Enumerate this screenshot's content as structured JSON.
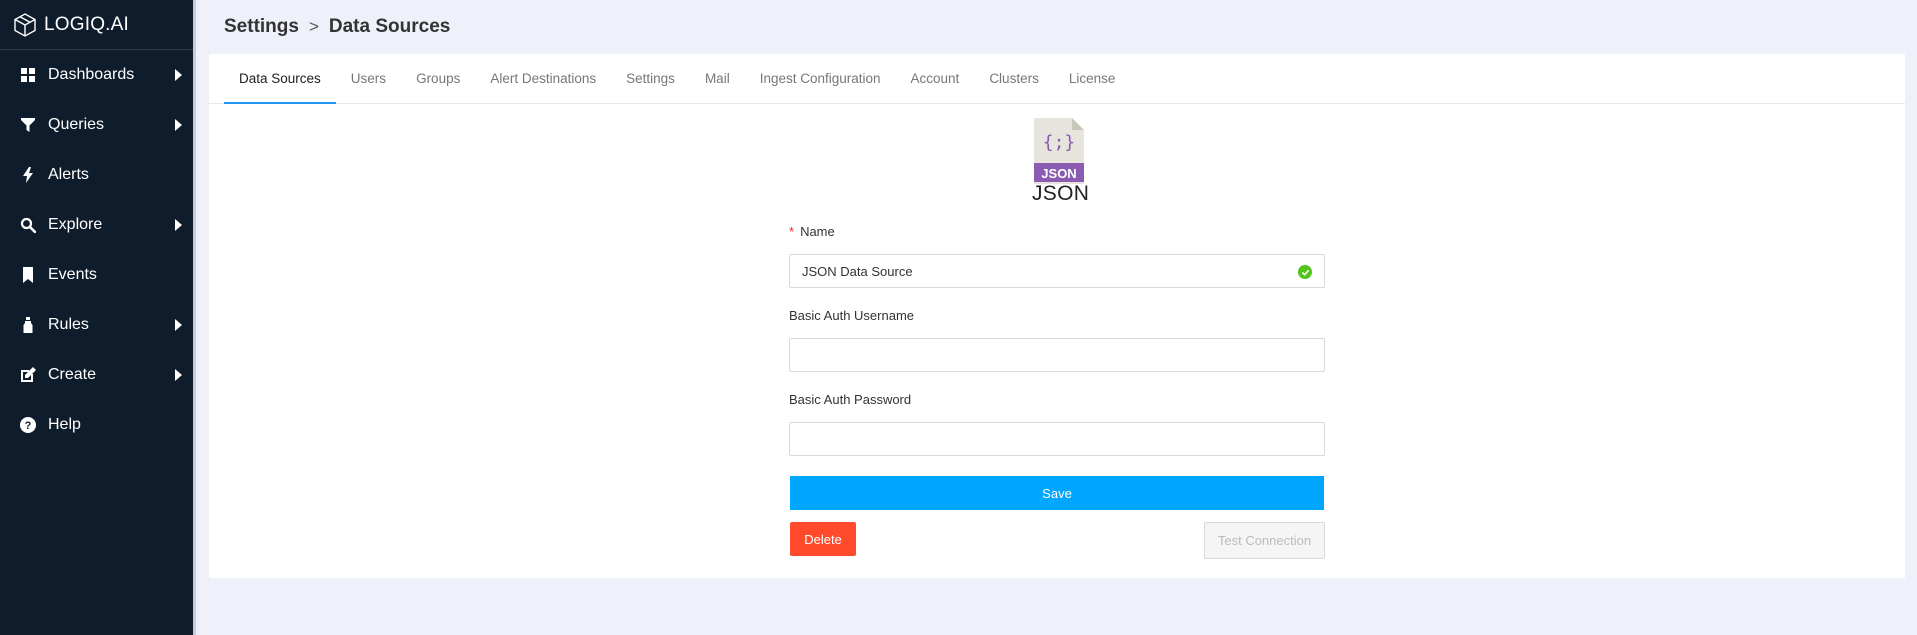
{
  "app": {
    "brand": "LOGIQ.AI"
  },
  "sidebar": {
    "items": [
      {
        "label": "Dashboards",
        "icon": "dashboard-grid-icon",
        "has_submenu": true
      },
      {
        "label": "Queries",
        "icon": "filter-funnel-icon",
        "has_submenu": true
      },
      {
        "label": "Alerts",
        "icon": "lightning-bolt-icon",
        "has_submenu": false
      },
      {
        "label": "Explore",
        "icon": "search-icon",
        "has_submenu": true
      },
      {
        "label": "Events",
        "icon": "bookmark-icon",
        "has_submenu": false
      },
      {
        "label": "Rules",
        "icon": "bottle-icon",
        "has_submenu": true
      },
      {
        "label": "Create",
        "icon": "edit-square-icon",
        "has_submenu": true
      },
      {
        "label": "Help",
        "icon": "question-circle-icon",
        "has_submenu": false
      }
    ]
  },
  "header": {
    "crumb_root": "Settings",
    "separator": ">",
    "crumb_current": "Data Sources"
  },
  "tabs": [
    {
      "label": "Data Sources",
      "active": true
    },
    {
      "label": "Users",
      "active": false
    },
    {
      "label": "Groups",
      "active": false
    },
    {
      "label": "Alert Destinations",
      "active": false
    },
    {
      "label": "Settings",
      "active": false
    },
    {
      "label": "Mail",
      "active": false
    },
    {
      "label": "Ingest Configuration",
      "active": false
    },
    {
      "label": "Account",
      "active": false
    },
    {
      "label": "Clusters",
      "active": false
    },
    {
      "label": "License",
      "active": false
    }
  ],
  "datasource": {
    "file_glyph": "{;}",
    "badge": "JSON",
    "name": "JSON"
  },
  "form": {
    "name_required_mark": "*",
    "name_label": "Name",
    "name_value": "JSON Data Source",
    "username_label": "Basic Auth Username",
    "username_value": "",
    "password_label": "Basic Auth Password",
    "password_value": "",
    "save_label": "Save",
    "delete_label": "Delete",
    "test_label": "Test Connection"
  },
  "colors": {
    "sidebar_bg": "#0f1c2c",
    "page_bg": "#eef0fa",
    "tab_active_underline": "#2196f3",
    "save_button": "#00a6ff",
    "delete_button": "#ff4a2c",
    "valid_check": "#52c41a",
    "json_badge": "#8a5bb0"
  }
}
